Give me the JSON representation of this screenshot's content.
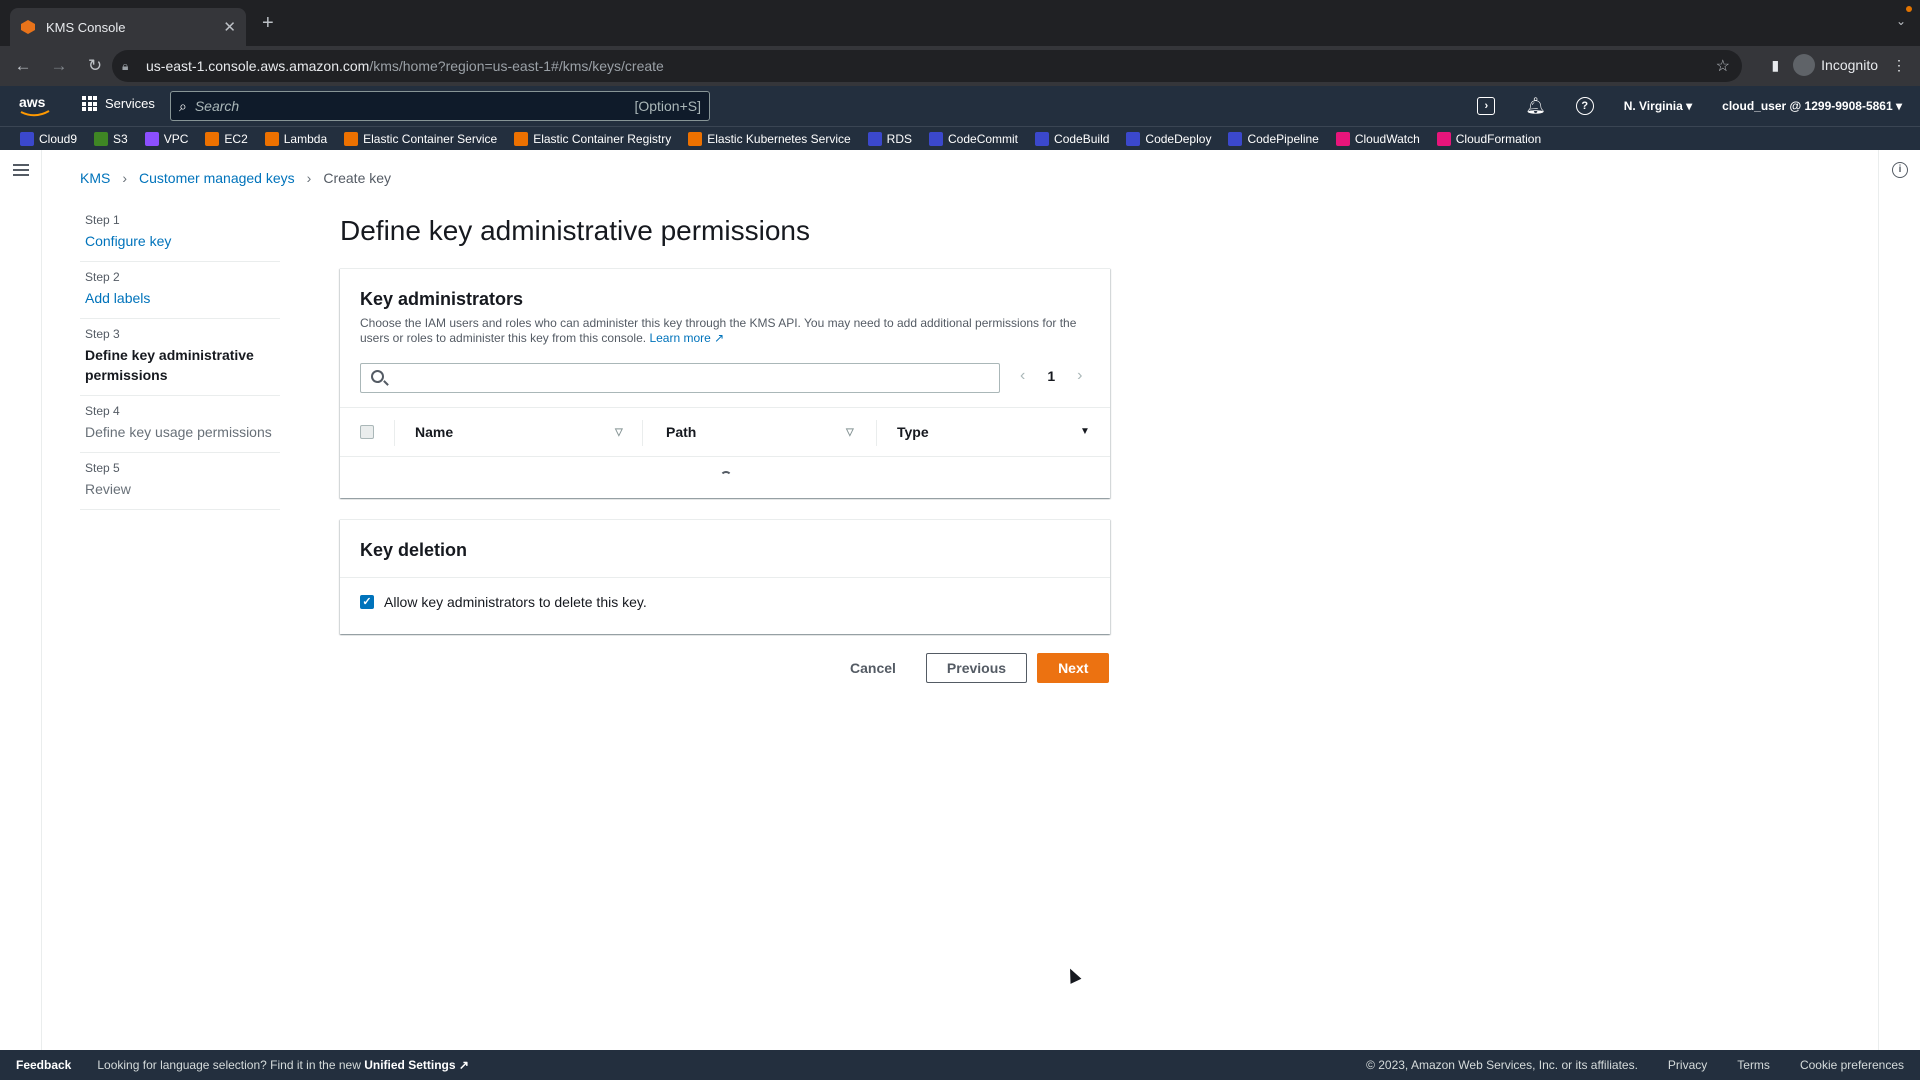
{
  "browser": {
    "tab_title": "KMS Console",
    "url_host": "us-east-1.console.aws.amazon.com",
    "url_path": "/kms/home?region=us-east-1#/kms/keys/create",
    "profile": "Incognito"
  },
  "aws_header": {
    "services_label": "Services",
    "search_placeholder": "Search",
    "search_shortcut": "[Option+S]",
    "region": "N. Virginia ▾",
    "account": "cloud_user @ 1299-9908-5861 ▾"
  },
  "favorites": [
    {
      "label": "Cloud9",
      "color": "#3b48cc"
    },
    {
      "label": "S3",
      "color": "#3f8624"
    },
    {
      "label": "VPC",
      "color": "#8c4fff"
    },
    {
      "label": "EC2",
      "color": "#ed7100"
    },
    {
      "label": "Lambda",
      "color": "#ed7100"
    },
    {
      "label": "Elastic Container Service",
      "color": "#ed7100"
    },
    {
      "label": "Elastic Container Registry",
      "color": "#ed7100"
    },
    {
      "label": "Elastic Kubernetes Service",
      "color": "#ed7100"
    },
    {
      "label": "RDS",
      "color": "#3b48cc"
    },
    {
      "label": "CodeCommit",
      "color": "#3b48cc"
    },
    {
      "label": "CodeBuild",
      "color": "#3b48cc"
    },
    {
      "label": "CodeDeploy",
      "color": "#3b48cc"
    },
    {
      "label": "CodePipeline",
      "color": "#3b48cc"
    },
    {
      "label": "CloudWatch",
      "color": "#e7157b"
    },
    {
      "label": "CloudFormation",
      "color": "#e7157b"
    }
  ],
  "breadcrumb": {
    "kms": "KMS",
    "keys": "Customer managed keys",
    "current": "Create key"
  },
  "steps": [
    {
      "label": "Step 1",
      "name": "Configure key",
      "state": "link"
    },
    {
      "label": "Step 2",
      "name": "Add labels",
      "state": "link"
    },
    {
      "label": "Step 3",
      "name": "Define key administrative permissions",
      "state": "active"
    },
    {
      "label": "Step 4",
      "name": "Define key usage permissions",
      "state": "disabled"
    },
    {
      "label": "Step 5",
      "name": "Review",
      "state": "disabled"
    }
  ],
  "page_title": "Define key administrative permissions",
  "key_admins": {
    "title": "Key administrators",
    "description": "Choose the IAM users and roles who can administer this key through the KMS API. You may need to add additional permissions for the users or roles to administer this key from this console.",
    "learn_more": "Learn more",
    "page_number": "1",
    "columns": {
      "name": "Name",
      "path": "Path",
      "type": "Type"
    }
  },
  "key_deletion": {
    "title": "Key deletion",
    "checkbox_label": "Allow key administrators to delete this key.",
    "checked": true
  },
  "actions": {
    "cancel": "Cancel",
    "previous": "Previous",
    "next": "Next"
  },
  "footer": {
    "feedback": "Feedback",
    "lang_text": "Looking for language selection? Find it in the new",
    "unified_settings": "Unified Settings",
    "copyright": "© 2023, Amazon Web Services, Inc. or its affiliates.",
    "privacy": "Privacy",
    "terms": "Terms",
    "cookies": "Cookie preferences"
  },
  "colors": {
    "accent": "#ec7211",
    "link": "#0073bb",
    "nav_bg": "#232f3e"
  }
}
